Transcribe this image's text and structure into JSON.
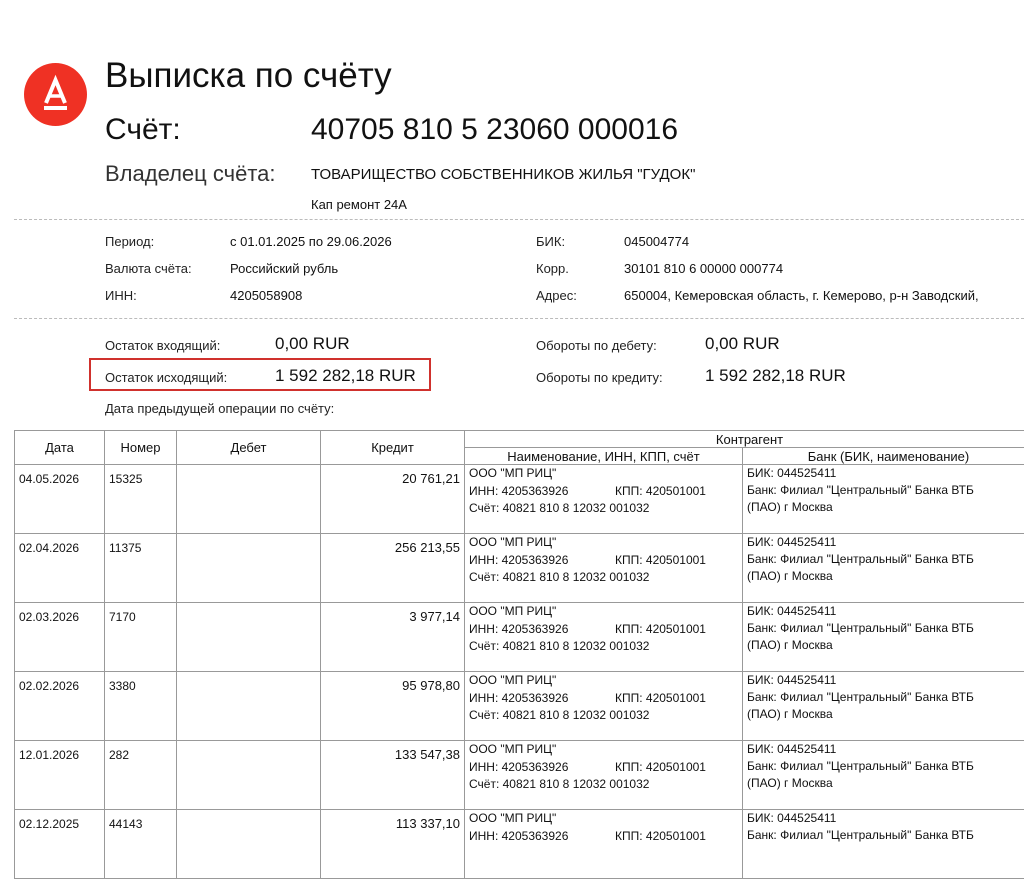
{
  "header": {
    "title": "Выписка по счёту",
    "account_label": "Счёт:",
    "account_number": "40705 810 5 23060 000016",
    "owner_label": "Владелец счёта:",
    "owner_name": "ТОВАРИЩЕСТВО СОБСТВЕННИКОВ ЖИЛЬЯ \"ГУДОК\"",
    "owner_sub": "Кап ремонт 24А",
    "logo_letter": "А",
    "brand_color": "#ef3124"
  },
  "details": {
    "period_label": "Период:",
    "period_value": "с 01.01.2025 по 29.06.2026",
    "currency_label": "Валюта счёта:",
    "currency_value": "Российский рубль",
    "inn_label": "ИНН:",
    "inn_value": "4205058908",
    "bik_label": "БИК:",
    "bik_value": "045004774",
    "corr_label": "Корр.",
    "corr_value": "30101 810 6 00000 000774",
    "address_label": "Адрес:",
    "address_value": "650004, Кемеровская область, г. Кемерово, р-н Заводский,"
  },
  "balances": {
    "incoming_label": "Остаток входящий:",
    "incoming_value": "0,00 RUR",
    "outgoing_label": "Остаток исходящий:",
    "outgoing_value": "1 592 282,18 RUR",
    "debit_turnover_label": "Обороты по дебету:",
    "debit_turnover_value": "0,00 RUR",
    "credit_turnover_label": "Обороты по кредиту:",
    "credit_turnover_value": "1 592 282,18 RUR",
    "prev_op_label": "Дата предыдущей операции по счёту:"
  },
  "table": {
    "headers": {
      "date": "Дата",
      "number": "Номер",
      "debit": "Дебет",
      "credit": "Кредит",
      "counterparty": "Контрагент",
      "cp_name": "Наименование, ИНН, КПП, счёт",
      "cp_bank": "Банк (БИК, наименование)"
    },
    "rows": [
      {
        "date": "04.05.2026",
        "number": "15325",
        "debit": "",
        "credit": "20 761,21",
        "cp_name": "ООО \"МП РИЦ\"",
        "cp_inn": "ИНН: 4205363926",
        "cp_kpp": "КПП: 420501001",
        "cp_account": "Счёт: 40821 810 8 12032 001032",
        "bank_bik": "БИК:  044525411",
        "bank_name1": "Банк:  Филиал \"Центральный\" Банка ВТБ",
        "bank_name2": "(ПАО) г Москва"
      },
      {
        "date": "02.04.2026",
        "number": "11375",
        "debit": "",
        "credit": "256 213,55",
        "cp_name": "ООО \"МП РИЦ\"",
        "cp_inn": "ИНН: 4205363926",
        "cp_kpp": "КПП: 420501001",
        "cp_account": "Счёт: 40821 810 8 12032 001032",
        "bank_bik": "БИК:  044525411",
        "bank_name1": "Банк:  Филиал \"Центральный\" Банка ВТБ",
        "bank_name2": "(ПАО) г Москва"
      },
      {
        "date": "02.03.2026",
        "number": "7170",
        "debit": "",
        "credit": "3 977,14",
        "cp_name": "ООО \"МП РИЦ\"",
        "cp_inn": "ИНН: 4205363926",
        "cp_kpp": "КПП: 420501001",
        "cp_account": "Счёт: 40821 810 8 12032 001032",
        "bank_bik": "БИК:  044525411",
        "bank_name1": "Банк:  Филиал \"Центральный\" Банка ВТБ",
        "bank_name2": "(ПАО) г Москва"
      },
      {
        "date": "02.02.2026",
        "number": "3380",
        "debit": "",
        "credit": "95 978,80",
        "cp_name": "ООО \"МП РИЦ\"",
        "cp_inn": "ИНН: 4205363926",
        "cp_kpp": "КПП: 420501001",
        "cp_account": "Счёт: 40821 810 8 12032 001032",
        "bank_bik": "БИК:  044525411",
        "bank_name1": "Банк:  Филиал \"Центральный\" Банка ВТБ",
        "bank_name2": "(ПАО) г Москва"
      },
      {
        "date": "12.01.2026",
        "number": "282",
        "debit": "",
        "credit": "133 547,38",
        "cp_name": "ООО \"МП РИЦ\"",
        "cp_inn": "ИНН: 4205363926",
        "cp_kpp": "КПП: 420501001",
        "cp_account": "Счёт: 40821 810 8 12032 001032",
        "bank_bik": "БИК:  044525411",
        "bank_name1": "Банк:  Филиал \"Центральный\" Банка ВТБ",
        "bank_name2": "(ПАО) г Москва"
      },
      {
        "date": "02.12.2025",
        "number": "44143",
        "debit": "",
        "credit": "113 337,10",
        "cp_name": "ООО \"МП РИЦ\"",
        "cp_inn": "ИНН: 4205363926",
        "cp_kpp": "КПП: 420501001",
        "cp_account": "",
        "bank_bik": "БИК:  044525411",
        "bank_name1": "Банк:  Филиал \"Центральный\" Банка ВТБ",
        "bank_name2": ""
      }
    ]
  }
}
